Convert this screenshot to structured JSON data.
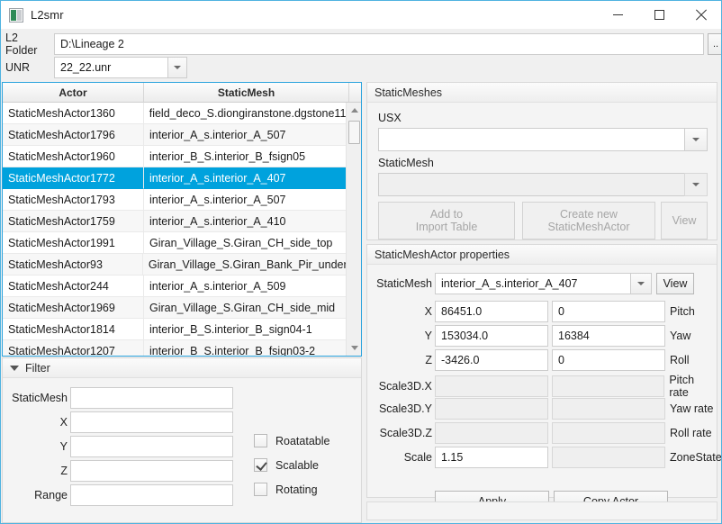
{
  "window": {
    "title": "L2smr",
    "icon": "app-icon",
    "controls": {
      "minimize": "minimize-icon",
      "maximize": "maximize-icon",
      "close": "close-icon"
    }
  },
  "top_form": {
    "l2_folder_label": "L2 Folder",
    "l2_folder_value": "D:\\Lineage 2",
    "browse_label": "..",
    "unr_label": "UNR",
    "unr_value": "22_22.unr"
  },
  "actor_table": {
    "columns": [
      "Actor",
      "StaticMesh"
    ],
    "selected_index": 3,
    "rows": [
      {
        "actor": "StaticMeshActor1360",
        "mesh": "field_deco_S.diongiranstone.dgstone11"
      },
      {
        "actor": "StaticMeshActor1796",
        "mesh": "interior_A_s.interior_A_507"
      },
      {
        "actor": "StaticMeshActor1960",
        "mesh": "interior_B_S.interior_B_fsign05"
      },
      {
        "actor": "StaticMeshActor1772",
        "mesh": "interior_A_s.interior_A_407"
      },
      {
        "actor": "StaticMeshActor1793",
        "mesh": "interior_A_s.interior_A_507"
      },
      {
        "actor": "StaticMeshActor1759",
        "mesh": "interior_A_s.interior_A_410"
      },
      {
        "actor": "StaticMeshActor1991",
        "mesh": "Giran_Village_S.Giran_CH_side_top"
      },
      {
        "actor": "StaticMeshActor93",
        "mesh": "Giran_Village_S.Giran_Bank_Pir_under"
      },
      {
        "actor": "StaticMeshActor244",
        "mesh": "interior_A_s.interior_A_509"
      },
      {
        "actor": "StaticMeshActor1969",
        "mesh": "Giran_Village_S.Giran_CH_side_mid"
      },
      {
        "actor": "StaticMeshActor1814",
        "mesh": "interior_B_S.interior_B_sign04-1"
      },
      {
        "actor": "StaticMeshActor1207",
        "mesh": "interior_B_S.interior_B_fsign03-2"
      }
    ]
  },
  "filter": {
    "title": "Filter",
    "fields": [
      {
        "label": "StaticMesh",
        "value": ""
      },
      {
        "label": "X",
        "value": ""
      },
      {
        "label": "Y",
        "value": ""
      },
      {
        "label": "Z",
        "value": ""
      },
      {
        "label": "Range",
        "value": ""
      }
    ],
    "checkboxes": [
      {
        "label": "Roatatable",
        "checked": false
      },
      {
        "label": "Scalable",
        "checked": true
      },
      {
        "label": "Rotating",
        "checked": false
      }
    ]
  },
  "staticmeshes_panel": {
    "title": "StaticMeshes",
    "usx_label": "USX",
    "usx_value": "",
    "staticmesh_label": "StaticMesh",
    "staticmesh_value": "",
    "add_to_import_table_label": "Add to\nImport Table",
    "add_to_import_table_line1": "Add to",
    "add_to_import_table_line2": "Import Table",
    "create_new_line1": "Create new",
    "create_new_line2": "StaticMeshActor",
    "view_label": "View"
  },
  "properties_panel": {
    "title": "StaticMeshActor properties",
    "staticmesh_label": "StaticMesh",
    "staticmesh_value": "interior_A_s.interior_A_407",
    "view_label": "View",
    "rows": [
      {
        "left_label": "X",
        "left_value": "86451.0",
        "right_value": "0",
        "right_label": "Pitch",
        "enabled": true
      },
      {
        "left_label": "Y",
        "left_value": "153034.0",
        "right_value": "16384",
        "right_label": "Yaw",
        "enabled": true
      },
      {
        "left_label": "Z",
        "left_value": "-3426.0",
        "right_value": "0",
        "right_label": "Roll",
        "enabled": true
      },
      {
        "left_label": "Scale3D.X",
        "left_value": "",
        "right_value": "",
        "right_label": "Pitch rate",
        "enabled": false
      },
      {
        "left_label": "Scale3D.Y",
        "left_value": "",
        "right_value": "",
        "right_label": "Yaw rate",
        "enabled": false
      },
      {
        "left_label": "Scale3D.Z",
        "left_value": "",
        "right_value": "",
        "right_label": "Roll rate",
        "enabled": false
      },
      {
        "left_label": "Scale",
        "left_value": "1.15",
        "right_value": "",
        "right_label": "ZoneState",
        "enabled": true
      }
    ],
    "apply_label": "Apply",
    "copy_actor_label": "Copy Actor"
  },
  "colors": {
    "window_border": "#4fb3e0",
    "selection": "#00a2dd",
    "table_border": "#2aa3dd"
  }
}
